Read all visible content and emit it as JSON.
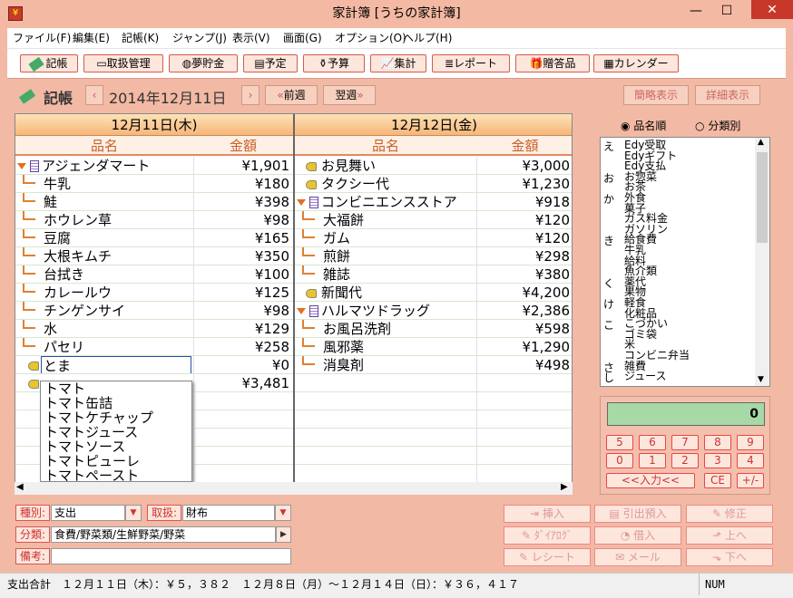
{
  "window": {
    "title": "家計簿 [うちの家計簿]",
    "min": "—",
    "max": "☐",
    "close": "✕"
  },
  "menu": [
    "ファイル(F)",
    "編集(E)",
    "記帳(K)",
    "ジャンプ(J)",
    "表示(V)",
    "画面(G)",
    "オプション(O)",
    "ヘルプ(H)"
  ],
  "toolbar": [
    "記帳",
    "取扱管理",
    "夢貯金",
    "予定",
    "予算",
    "集計",
    "レポート",
    "贈答品",
    "カレンダー"
  ],
  "nav": {
    "mode": "記帳",
    "date": "2014年12月11日",
    "prev_week": "前週",
    "next_week": "翌週",
    "simple_view": "簡略表示",
    "detail_view": "詳細表示"
  },
  "days": [
    {
      "header": "12月11日(木)",
      "col_name": "品名",
      "col_amount": "金額",
      "rows": [
        {
          "name": "アジェンダマート",
          "amount": "¥1,901",
          "kind": "store"
        },
        {
          "name": "牛乳",
          "amount": "¥180",
          "kind": "child"
        },
        {
          "name": "鮭",
          "amount": "¥398",
          "kind": "child"
        },
        {
          "name": "ホウレン草",
          "amount": "¥98",
          "kind": "child"
        },
        {
          "name": "豆腐",
          "amount": "¥165",
          "kind": "child"
        },
        {
          "name": "大根キムチ",
          "amount": "¥350",
          "kind": "child"
        },
        {
          "name": "台拭き",
          "amount": "¥100",
          "kind": "child"
        },
        {
          "name": "カレールウ",
          "amount": "¥125",
          "kind": "child"
        },
        {
          "name": "チンゲンサイ",
          "amount": "¥98",
          "kind": "child"
        },
        {
          "name": "水",
          "amount": "¥129",
          "kind": "child"
        },
        {
          "name": "パセリ",
          "amount": "¥258",
          "kind": "child"
        },
        {
          "name": "とま",
          "amount": "¥0",
          "kind": "edit"
        },
        {
          "name": "",
          "amount": "¥3,481",
          "kind": "tag"
        }
      ]
    },
    {
      "header": "12月12日(金)",
      "col_name": "品名",
      "col_amount": "金額",
      "rows": [
        {
          "name": "お見舞い",
          "amount": "¥3,000",
          "kind": "tag"
        },
        {
          "name": "タクシー代",
          "amount": "¥1,230",
          "kind": "tag"
        },
        {
          "name": "コンビニエンスストア",
          "amount": "¥918",
          "kind": "store"
        },
        {
          "name": "大福餅",
          "amount": "¥120",
          "kind": "child"
        },
        {
          "name": "ガム",
          "amount": "¥120",
          "kind": "child"
        },
        {
          "name": "煎餅",
          "amount": "¥298",
          "kind": "child"
        },
        {
          "name": "雑誌",
          "amount": "¥380",
          "kind": "child"
        },
        {
          "name": "新聞代",
          "amount": "¥4,200",
          "kind": "tag"
        },
        {
          "name": "ハルマツドラッグ",
          "amount": "¥2,386",
          "kind": "store"
        },
        {
          "name": "お風呂洗剤",
          "amount": "¥598",
          "kind": "child"
        },
        {
          "name": "風邪薬",
          "amount": "¥1,290",
          "kind": "child"
        },
        {
          "name": "消臭剤",
          "amount": "¥498",
          "kind": "child"
        }
      ]
    }
  ],
  "autocomplete": [
    "トマト",
    "トマト缶詰",
    "トマトケチャップ",
    "トマトジュース",
    "トマトソース",
    "トマトピューレ",
    "トマトペースト"
  ],
  "sort": {
    "by_name": "品名順",
    "by_category": "分類別"
  },
  "item_list": [
    {
      "kana": "え",
      "items": [
        "Edy受取",
        "Edyギフト",
        "Edy支払"
      ]
    },
    {
      "kana": "お",
      "items": [
        "お惣菜",
        "お茶"
      ]
    },
    {
      "kana": "か",
      "items": [
        "外食",
        "菓子",
        "ガス料金",
        "ガソリン"
      ]
    },
    {
      "kana": "き",
      "items": [
        "給食費",
        "牛乳",
        "給料",
        "魚介類"
      ]
    },
    {
      "kana": "く",
      "items": [
        "薬代",
        "果物"
      ]
    },
    {
      "kana": "け",
      "items": [
        "軽食",
        "化粧品"
      ]
    },
    {
      "kana": "こ",
      "items": [
        "こづかい",
        "ゴミ袋",
        "米",
        "コンビニ弁当"
      ]
    },
    {
      "kana": "さ",
      "items": [
        "雑費"
      ]
    },
    {
      "kana": "し",
      "items": [
        "ジュース"
      ]
    }
  ],
  "calculator": {
    "display": "0",
    "keys": [
      "5",
      "6",
      "7",
      "8",
      "9",
      "0",
      "1",
      "2",
      "3",
      "4"
    ],
    "input_key": "<<入力<<",
    "ce": "CE",
    "plusminus": "+/-"
  },
  "form": {
    "type_label": "種別:",
    "type_value": "支出",
    "handling_label": "取扱:",
    "handling_value": "財布",
    "category_label": "分類:",
    "category_value": "食費/野菜類/生鮮野菜/野菜",
    "memo_label": "備考:",
    "memo_value": ""
  },
  "actions": [
    "挿入",
    "引出預入",
    "修正",
    "ﾀﾞｲｱﾛｸﾞ",
    "借入",
    "上へ",
    "レシート",
    "メール",
    "下へ"
  ],
  "status": {
    "text": "支出合計　１２月１１日（木）：￥５，３８２　１２月８日（月）～１２月１４日（日）：￥３６，４１７",
    "num": "NUM"
  }
}
